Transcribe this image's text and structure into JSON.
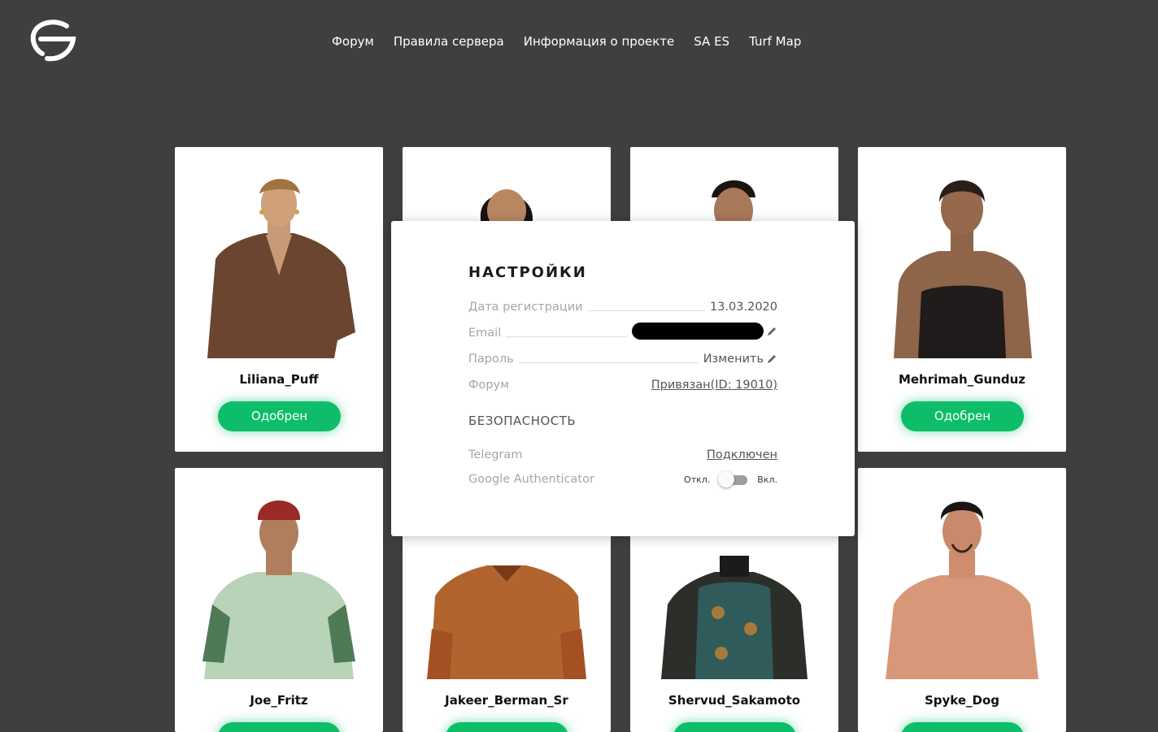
{
  "header": {
    "nav": [
      "Форум",
      "Правила сервера",
      "Информация о проекте",
      "SA ES",
      "Turf Map"
    ]
  },
  "characters": [
    {
      "name": "Liliana_Puff",
      "status": "Одобрен"
    },
    {
      "name": "",
      "status": ""
    },
    {
      "name": "",
      "status": ""
    },
    {
      "name": "Mehrimah_Gunduz",
      "status": "Одобрен"
    },
    {
      "name": "Joe_Fritz",
      "status": ""
    },
    {
      "name": "Jakeer_Berman_Sr",
      "status": ""
    },
    {
      "name": "Shervud_Sakamoto",
      "status": ""
    },
    {
      "name": "Spyke_Dog",
      "status": ""
    }
  ],
  "settings": {
    "title": "НАСТРОЙКИ",
    "reg_date_label": "Дата регистрации",
    "reg_date_value": "13.03.2020",
    "email_label": "Email",
    "password_label": "Пароль",
    "password_action": "Изменить",
    "forum_label": "Форум",
    "forum_value": "Привязан(ID: 19010)",
    "security_title": "БЕЗОПАСНОСТЬ",
    "telegram_label": "Telegram",
    "telegram_value": "Подключен",
    "ga_label": "Google Authenticator",
    "toggle_off": "Откл.",
    "toggle_on": "Вкл.",
    "ga_enabled": false
  },
  "colors": {
    "background": "#3e3f41",
    "accent_green": "#0dbd69",
    "card": "#ffffff"
  }
}
